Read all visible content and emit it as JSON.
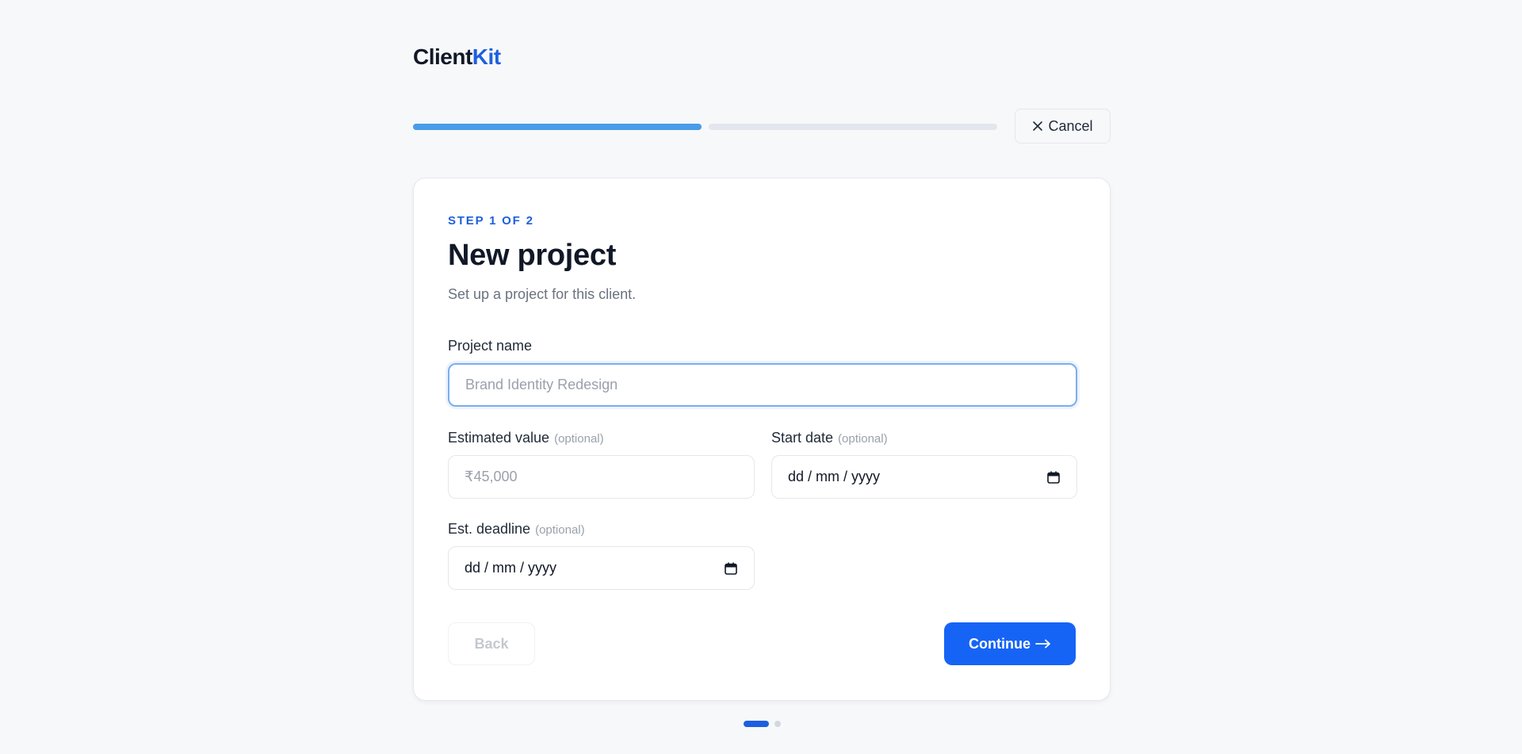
{
  "brand": {
    "name_prefix": "Client",
    "name_suffix": "Kit"
  },
  "progress": {
    "current_step": 1,
    "total_steps": 2,
    "step1_fill_fraction": 1.0,
    "step2_fill_fraction": 0.0
  },
  "header": {
    "cancel_label": "Cancel"
  },
  "form": {
    "step_label": "STEP 1 OF 2",
    "title": "New project",
    "subtitle": "Set up a project for this client.",
    "project_name": {
      "label": "Project name",
      "placeholder": "Brand Identity Redesign",
      "value": ""
    },
    "estimated_value": {
      "label": "Estimated value",
      "optional": "(optional)",
      "placeholder": "₹45,000",
      "value": ""
    },
    "start_date": {
      "label": "Start date",
      "optional": "(optional)",
      "placeholder": "dd / mm / yyyy"
    },
    "deadline": {
      "label": "Est. deadline",
      "optional": "(optional)",
      "placeholder": "dd / mm / yyyy"
    }
  },
  "footer": {
    "back_label": "Back",
    "continue_label": "Continue"
  },
  "pager": {
    "active_index": 0,
    "count": 2
  },
  "colors": {
    "accent": "#1d5fe0",
    "button": "#1664f5",
    "progress_fill": "#4a9cea"
  }
}
